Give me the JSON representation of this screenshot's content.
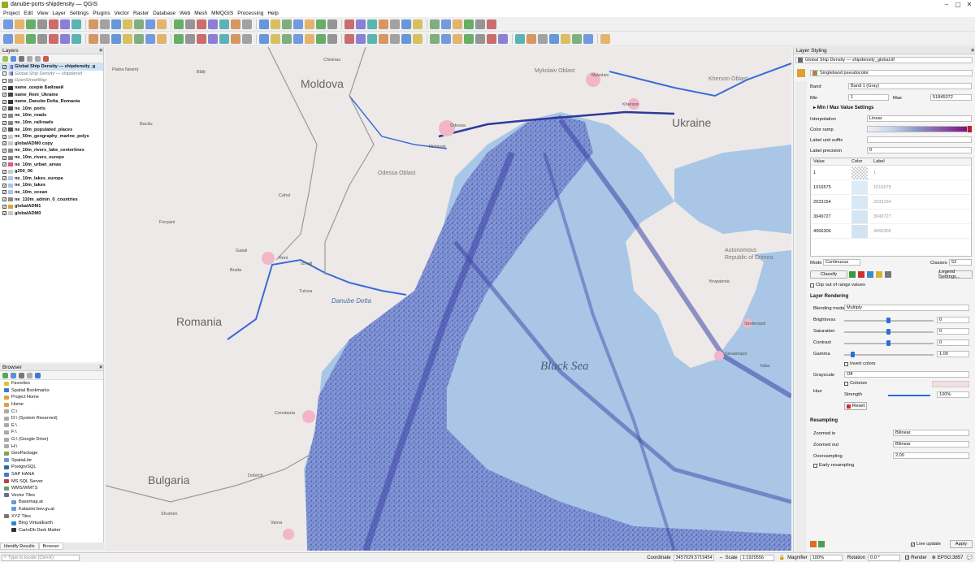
{
  "window": {
    "title": "danube-ports-shipdensity — QGIS",
    "min_label": "–",
    "max_label": "▢",
    "close_label": "✕"
  },
  "menu": [
    "Project",
    "Edit",
    "View",
    "Layer",
    "Settings",
    "Plugins",
    "Vector",
    "Raster",
    "Database",
    "Web",
    "Mesh",
    "MMQGIS",
    "Processing",
    "Help"
  ],
  "layers_panel": {
    "title": "Layers",
    "items": [
      {
        "label": "Global Ship Density — shipdensity_g",
        "checked": true,
        "bold": true,
        "italic": false,
        "symbol": "raster-icon"
      },
      {
        "label": "Global Ship Density — shipdensit",
        "checked": false,
        "bold": false,
        "italic": true,
        "symbol": "raster-icon"
      },
      {
        "label": "OpenStreetMap",
        "checked": false,
        "bold": false,
        "italic": true,
        "symbol": "xyz-icon"
      },
      {
        "label": "name_ozepie Бийзкий",
        "checked": true,
        "bold": true,
        "italic": false,
        "symbol": "label-icon"
      },
      {
        "label": "name_Reni_Ukraine",
        "checked": true,
        "bold": true,
        "italic": false,
        "symbol": "anchor-icon"
      },
      {
        "label": "name_Danube Delta_Romania",
        "checked": true,
        "bold": true,
        "italic": false,
        "symbol": "label-icon"
      },
      {
        "label": "ne_10m_ports",
        "checked": true,
        "bold": true,
        "italic": false,
        "symbol": "anchor-icon"
      },
      {
        "label": "ne_10m_roads",
        "checked": true,
        "bold": true,
        "italic": false,
        "symbol": "line-icon"
      },
      {
        "label": "ne_10m_railroads",
        "checked": true,
        "bold": true,
        "italic": false,
        "symbol": "line-icon"
      },
      {
        "label": "ne_10m_populated_places",
        "checked": true,
        "bold": true,
        "italic": false,
        "symbol": "point-icon"
      },
      {
        "label": "ne_50m_geography_marine_polys",
        "checked": true,
        "bold": true,
        "italic": false,
        "symbol": "poly-icon"
      },
      {
        "label": "globalADM0 copy",
        "checked": true,
        "bold": true,
        "italic": false,
        "symbol": "poly-icon"
      },
      {
        "label": "ne_10m_rivers_lake_centerlines",
        "checked": true,
        "bold": true,
        "italic": false,
        "symbol": "line-icon"
      },
      {
        "label": "ne_10m_rivers_europe",
        "checked": true,
        "bold": true,
        "italic": false,
        "symbol": "line-icon"
      },
      {
        "label": "ne_10m_urban_areas",
        "checked": true,
        "bold": true,
        "italic": false,
        "symbol": "urban-icon"
      },
      {
        "label": "g250_06",
        "checked": true,
        "bold": true,
        "italic": false,
        "symbol": "poly-icon"
      },
      {
        "label": "ne_10m_lakes_europe",
        "checked": true,
        "bold": true,
        "italic": false,
        "symbol": "water-icon"
      },
      {
        "label": "ne_10m_lakes",
        "checked": true,
        "bold": true,
        "italic": false,
        "symbol": "water-icon"
      },
      {
        "label": "ne_10m_ocean",
        "checked": true,
        "bold": true,
        "italic": false,
        "symbol": "water-icon"
      },
      {
        "label": "ne_110m_admin_0_countries",
        "checked": true,
        "bold": true,
        "italic": false,
        "symbol": "line-icon"
      },
      {
        "label": "globalADM1",
        "checked": true,
        "bold": true,
        "italic": false,
        "symbol": "pencil-icon"
      },
      {
        "label": "globalADM0",
        "checked": true,
        "bold": true,
        "italic": false,
        "symbol": "poly-icon"
      }
    ]
  },
  "browser_panel": {
    "title": "Browser",
    "items": [
      "Favorites",
      "Spatial Bookmarks",
      "Project Home",
      "Home",
      "C:\\",
      "D:\\ (System Reserved)",
      "E:\\",
      "F:\\",
      "G:\\ (Google Drive)",
      "H:\\",
      "GeoPackage",
      "SpatiaLite",
      "PostgreSQL",
      "SAP HANA",
      "MS SQL Server",
      "WMS/WMTS",
      "Vector Tiles",
      "Basemap.at",
      "Kataster.bev.gv.at",
      "XYZ Tiles",
      "Bing VirtualEarth",
      "CartoDb Dark Matter"
    ],
    "tabs": [
      "Identify Results",
      "Browser"
    ]
  },
  "map": {
    "labels": {
      "moldova": "Moldova",
      "ukraine": "Ukraine",
      "romania": "Romania",
      "bulgaria": "Bulgaria",
      "black_sea": "Black Sea",
      "danube_delta": "Danube Delta",
      "odessa_oblast": "Odessa Oblast",
      "kherson_oblast": "Kherson Oblast",
      "mykolaiv_oblast": "Mykolaiv Oblast",
      "crimea": "Autonomous Republic of Crimea",
      "chisinau": "Chisinau",
      "odessa": "Odessa",
      "kherson": "Kherson",
      "simferopol": "Simferopol",
      "sevastopol": "Sevastopol",
      "constanta": "Constanta",
      "tulcea": "Tulcea",
      "braila": "Braila",
      "galati": "Galati",
      "izmail": "Izmail",
      "reni": "Reni",
      "varna": "Varna",
      "shumen": "Shumen",
      "dobrich": "Dobrich",
      "bacau": "Bacău",
      "focsani": "Focșani",
      "cahul": "Cahul",
      "balti": "Bălți",
      "piatra": "Piatra Neamț",
      "mykolaiv": "Mykolaiv",
      "yalta": "Yalta",
      "ilichivsk": "Illichivsk",
      "yevpatoria": "Yevpatoria"
    },
    "colors": {
      "land": "#ece9e8",
      "water": "#a9c6e6",
      "density": "#4b4fb0",
      "urban": "#f2b6c8",
      "border": "#9a9a9a",
      "river": "#3c6ad6"
    }
  },
  "styling": {
    "title": "Layer Styling",
    "layer": "Global Ship Density — shipdensity_global.tif",
    "renderer": "Singleband pseudocolor",
    "band_label": "Band",
    "band_value": "Band 1 (Gray)",
    "min_label": "Min",
    "min_value": "1",
    "max_label": "Max",
    "max_value": "51845372",
    "minmax_section": "Min / Max Value Settings",
    "interp_label": "Interpolation",
    "interp_value": "Linear",
    "ramp_label": "Color ramp",
    "suffix_label": "Label unit suffix",
    "precision_label": "Label precision",
    "precision_value": "0",
    "table_headers": [
      "Value",
      "Color",
      "Label"
    ],
    "table_rows": [
      {
        "value": "1",
        "label": "1"
      },
      {
        "value": "1016575",
        "label": "1016575"
      },
      {
        "value": "2033154",
        "label": "2033154"
      },
      {
        "value": "3049727",
        "label": "3049727"
      },
      {
        "value": "4066306",
        "label": "4066306"
      }
    ],
    "mode_label": "Mode",
    "mode_value": "Continuous",
    "classes_label": "Classes",
    "classes_value": "52",
    "classify_label": "Classify",
    "legend_label": "Legend Settings...",
    "clip_label": "Clip out of range values",
    "rendering_section": "Layer Rendering",
    "blend_label": "Blending mode",
    "blend_value": "Multiply",
    "brightness_label": "Brightness",
    "brightness_value": "0",
    "saturation_label": "Saturation",
    "saturation_value": "0",
    "contrast_label": "Contrast",
    "contrast_value": "0",
    "gamma_label": "Gamma",
    "gamma_value": "1.00",
    "invert_label": "Invert colors",
    "grayscale_label": "Grayscale",
    "grayscale_value": "Off",
    "hue_label": "Hue",
    "colorize_label": "Colorize",
    "strength_label": "Strength",
    "strength_value": "100%",
    "reset_label": "Reset",
    "resampling_section": "Resampling",
    "zin_label": "Zoomed in",
    "zin_value": "Bilinear",
    "zout_label": "Zoomed out",
    "zout_value": "Bilinear",
    "overs_label": "Oversampling",
    "overs_value": "2.00",
    "early_label": "Early resampling",
    "live_label": "Live update",
    "apply_label": "Apply"
  },
  "status": {
    "locate_placeholder": "Type to locate (Ctrl+K)",
    "coord_label": "Coordinate",
    "coord_value": "3457029,5719454",
    "scale_label": "Scale",
    "scale_value": "1:1920556",
    "magnifier_label": "Magnifier",
    "magnifier_value": "100%",
    "rotation_label": "Rotation",
    "rotation_value": "0.0 °",
    "render_label": "Render",
    "crs_value": "EPSG:3857"
  }
}
